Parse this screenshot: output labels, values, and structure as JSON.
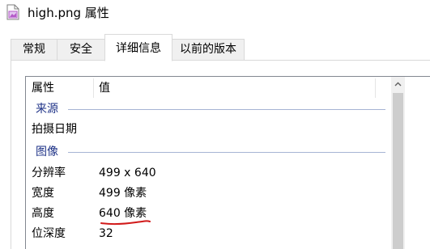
{
  "window": {
    "title": "high.png 属性",
    "icon": "image-file-icon"
  },
  "tabs": [
    {
      "label": "常规",
      "active": false
    },
    {
      "label": "安全",
      "active": false
    },
    {
      "label": "详细信息",
      "active": true
    },
    {
      "label": "以前的版本",
      "active": false
    }
  ],
  "details": {
    "columns": {
      "name": "属性",
      "value": "值"
    },
    "groups": [
      {
        "label": "来源",
        "rows": [
          {
            "name": "拍摄日期",
            "value": ""
          }
        ]
      },
      {
        "label": "图像",
        "rows": [
          {
            "name": "分辨率",
            "value": "499 x 640"
          },
          {
            "name": "宽度",
            "value": "499 像素"
          },
          {
            "name": "高度",
            "value": "640 像素"
          },
          {
            "name": "位深度",
            "value": "32"
          }
        ]
      }
    ]
  },
  "colors": {
    "group_label": "#1e3287",
    "group_line": "#a6b4d4",
    "annotation": "#d11a1a",
    "icon_accent": "#b45ac8"
  },
  "annotation": {
    "target_row": "高度",
    "type": "red-underline"
  }
}
